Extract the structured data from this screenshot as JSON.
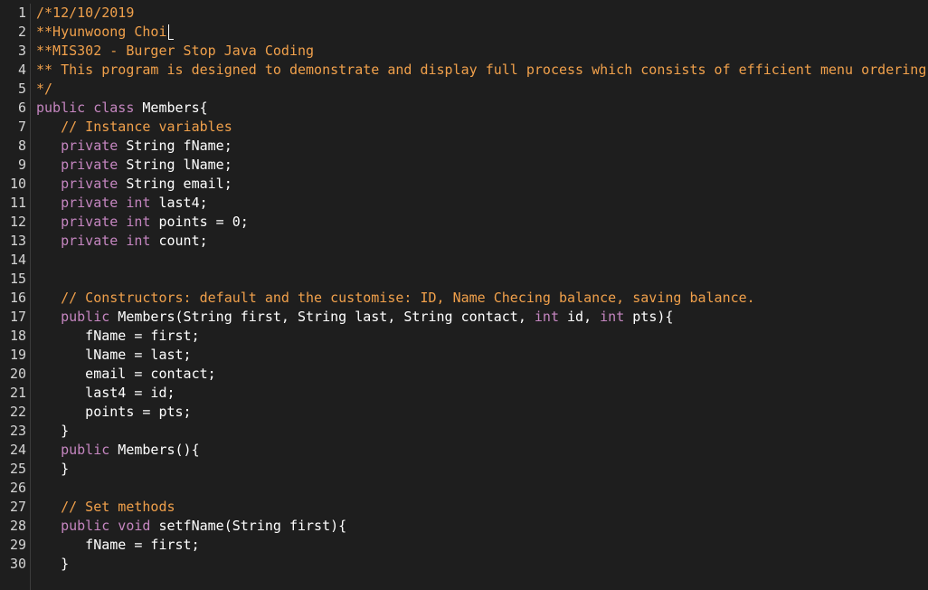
{
  "editor": {
    "cursor_line": 2,
    "line_numbers": [
      "1",
      "2",
      "3",
      "4",
      "5",
      "6",
      "7",
      "8",
      "9",
      "10",
      "11",
      "12",
      "13",
      "14",
      "15",
      "16",
      "17",
      "18",
      "19",
      "20",
      "21",
      "22",
      "23",
      "24",
      "25",
      "26",
      "27",
      "28",
      "29",
      "30"
    ],
    "lines": [
      [
        {
          "t": "/*12/10/2019",
          "c": "c"
        }
      ],
      [
        {
          "t": "**Hyunwoong Choi",
          "c": "c"
        }
      ],
      [
        {
          "t": "**MIS302 - Burger Stop Java Coding",
          "c": "c"
        }
      ],
      [
        {
          "t": "** This program is designed to demonstrate and display full process which consists of efficient menu ordering",
          "c": "c"
        }
      ],
      [
        {
          "t": "*/",
          "c": "c"
        }
      ],
      [
        {
          "t": "public class",
          "c": "k"
        },
        {
          "t": " Members{",
          "c": "t"
        }
      ],
      [
        {
          "t": "   ",
          "c": "t"
        },
        {
          "t": "// Instance variables",
          "c": "c"
        }
      ],
      [
        {
          "t": "   ",
          "c": "t"
        },
        {
          "t": "private",
          "c": "k"
        },
        {
          "t": " String fName;",
          "c": "t"
        }
      ],
      [
        {
          "t": "   ",
          "c": "t"
        },
        {
          "t": "private",
          "c": "k"
        },
        {
          "t": " String lName;",
          "c": "t"
        }
      ],
      [
        {
          "t": "   ",
          "c": "t"
        },
        {
          "t": "private",
          "c": "k"
        },
        {
          "t": " String email;",
          "c": "t"
        }
      ],
      [
        {
          "t": "   ",
          "c": "t"
        },
        {
          "t": "private int",
          "c": "k"
        },
        {
          "t": " last4;",
          "c": "t"
        }
      ],
      [
        {
          "t": "   ",
          "c": "t"
        },
        {
          "t": "private int",
          "c": "k"
        },
        {
          "t": " points = 0;",
          "c": "t"
        }
      ],
      [
        {
          "t": "   ",
          "c": "t"
        },
        {
          "t": "private int",
          "c": "k"
        },
        {
          "t": " count;",
          "c": "t"
        }
      ],
      [],
      [],
      [
        {
          "t": "   ",
          "c": "t"
        },
        {
          "t": "// Constructors: default and the customise: ID, Name Checing balance, saving balance.",
          "c": "c"
        }
      ],
      [
        {
          "t": "   ",
          "c": "t"
        },
        {
          "t": "public",
          "c": "k"
        },
        {
          "t": " Members(String first, String last, String contact, ",
          "c": "t"
        },
        {
          "t": "int",
          "c": "k"
        },
        {
          "t": " id, ",
          "c": "t"
        },
        {
          "t": "int",
          "c": "k"
        },
        {
          "t": " pts){",
          "c": "t"
        }
      ],
      [
        {
          "t": "      fName = first;",
          "c": "t"
        }
      ],
      [
        {
          "t": "      lName = last;",
          "c": "t"
        }
      ],
      [
        {
          "t": "      email = contact;",
          "c": "t"
        }
      ],
      [
        {
          "t": "      last4 = id;",
          "c": "t"
        }
      ],
      [
        {
          "t": "      points = pts;",
          "c": "t"
        }
      ],
      [
        {
          "t": "   }",
          "c": "t"
        }
      ],
      [
        {
          "t": "   ",
          "c": "t"
        },
        {
          "t": "public",
          "c": "k"
        },
        {
          "t": " Members(){",
          "c": "t"
        }
      ],
      [
        {
          "t": "   }",
          "c": "t"
        }
      ],
      [],
      [
        {
          "t": "   ",
          "c": "t"
        },
        {
          "t": "// Set methods",
          "c": "c"
        }
      ],
      [
        {
          "t": "   ",
          "c": "t"
        },
        {
          "t": "public void",
          "c": "k"
        },
        {
          "t": " setfName(String first){",
          "c": "t"
        }
      ],
      [
        {
          "t": "      fName = first;",
          "c": "t"
        }
      ],
      [
        {
          "t": "   }",
          "c": "t"
        }
      ]
    ]
  },
  "colors": {
    "background": "#1e1e1e",
    "comment": "#f0a04b",
    "keyword": "#c586c0",
    "text": "#ffffff",
    "line_number": "#d4d4d4"
  }
}
